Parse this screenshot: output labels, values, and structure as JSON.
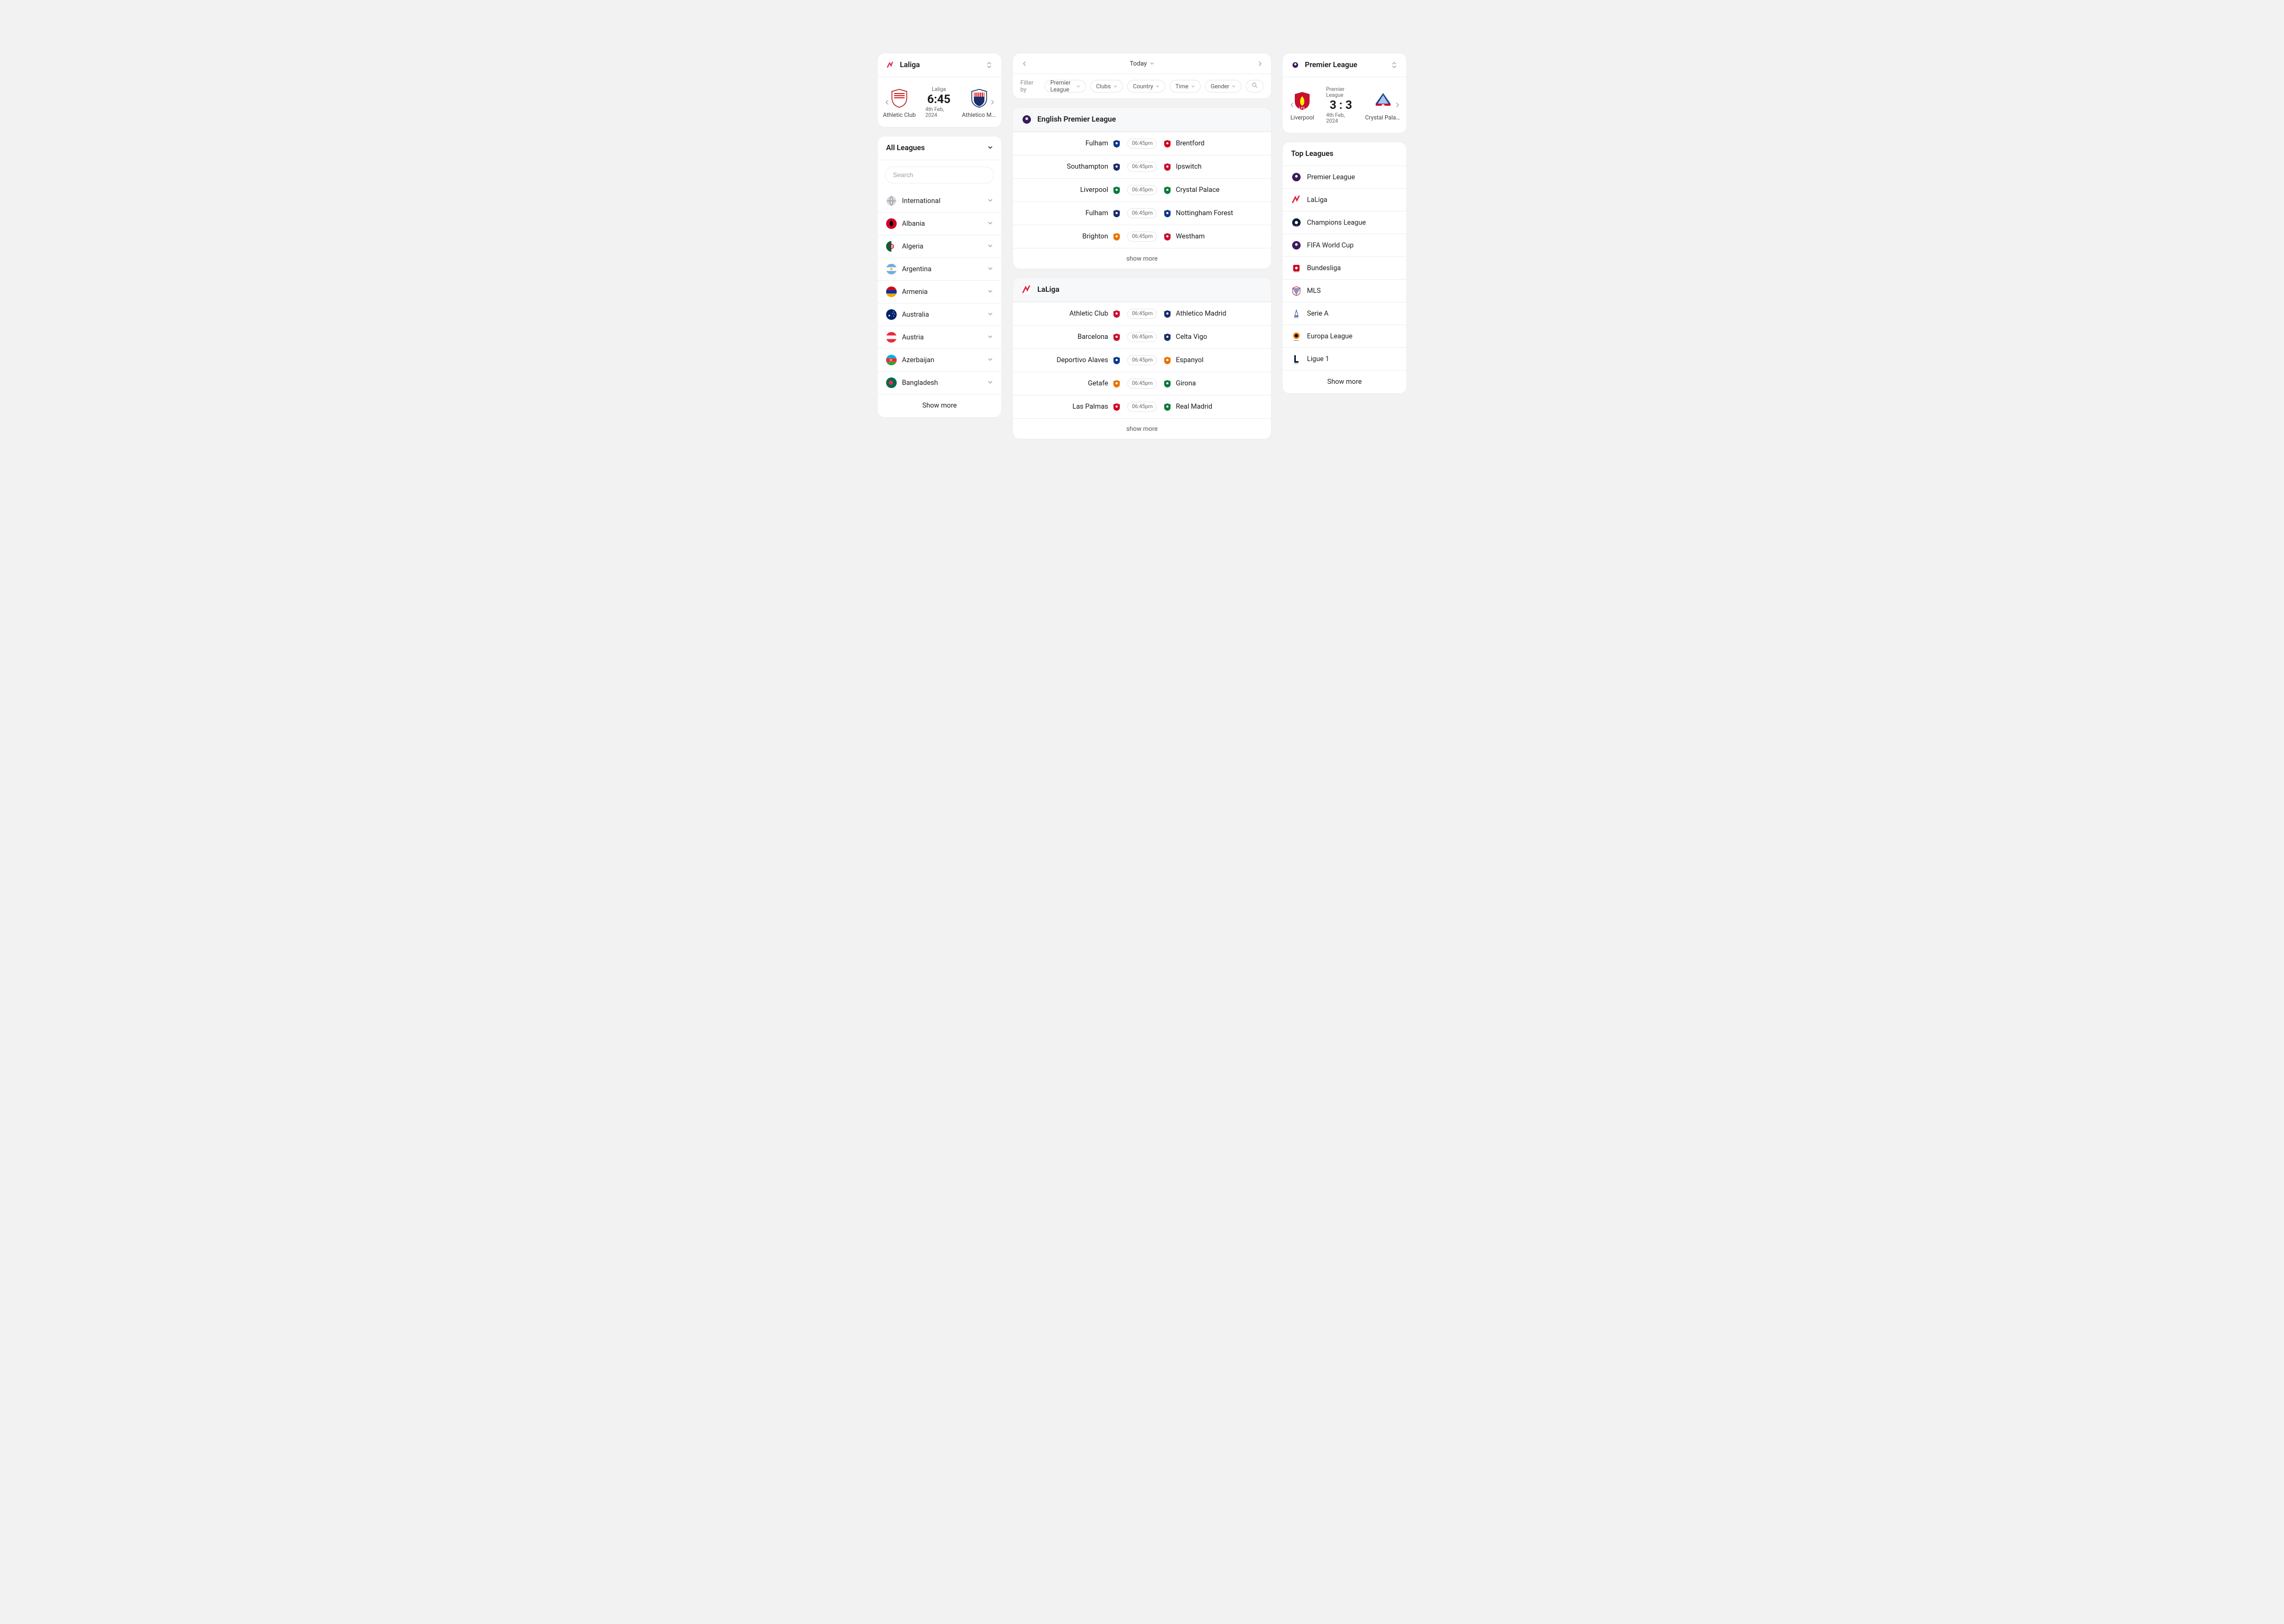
{
  "left": {
    "featured": {
      "title": "Laliga",
      "home": "Athletic Club",
      "away": "Athletico M...",
      "league": "Laliga",
      "score": "6:45",
      "date": "4th Feb, 2024"
    },
    "all_title": "All Leagues",
    "search_placeholder": "Search",
    "countries": [
      {
        "name": "International",
        "flag": "globe"
      },
      {
        "name": "Albania",
        "flag": "albania"
      },
      {
        "name": "Algeria",
        "flag": "algeria"
      },
      {
        "name": "Argentina",
        "flag": "argentina"
      },
      {
        "name": "Armenia",
        "flag": "armenia"
      },
      {
        "name": "Australia",
        "flag": "australia"
      },
      {
        "name": "Austria",
        "flag": "austria"
      },
      {
        "name": "Azerbaijan",
        "flag": "azerbaijan"
      },
      {
        "name": "Bangladesh",
        "flag": "bangladesh"
      }
    ],
    "show_more": "Show more"
  },
  "center": {
    "date_label": "Today",
    "filter_label": "Filter by",
    "filters": [
      "Premier League",
      "Clubs",
      "Country",
      "Time",
      "Gender"
    ],
    "search_placeholder": "Search",
    "groups": [
      {
        "title": "English Premier League",
        "icon": "epl",
        "matches": [
          {
            "home": "Fulham",
            "away": "Brentford",
            "time": "06:45pm"
          },
          {
            "home": "Southampton",
            "away": "Ipswitch",
            "time": "06:45pm"
          },
          {
            "home": "Liverpool",
            "away": "Crystal Palace",
            "time": "06:45pm"
          },
          {
            "home": "Fulham",
            "away": "Nottingham Forest",
            "time": "06:45pm"
          },
          {
            "home": "Brighton",
            "away": "Westham",
            "time": "06:45pm"
          }
        ],
        "show_more": "show more"
      },
      {
        "title": "LaLiga",
        "icon": "laliga",
        "matches": [
          {
            "home": "Athletic Club",
            "away": "Athletico Madrid",
            "time": "06:45pm"
          },
          {
            "home": "Barcelona",
            "away": "Celta Vigo",
            "time": "06:45pm"
          },
          {
            "home": "Deportivo Alaves",
            "away": "Espanyol",
            "time": "06:45pm"
          },
          {
            "home": "Getafe",
            "away": "Girona",
            "time": "06:45pm"
          },
          {
            "home": "Las Palmas",
            "away": "Real Madrid",
            "time": "06:45pm"
          }
        ],
        "show_more": "show more"
      }
    ]
  },
  "right": {
    "featured": {
      "title": "Premier League",
      "home": "Liverpool",
      "away": "Crystal Palace",
      "league": "Premier League",
      "score": "3 : 3",
      "date": "4th Feb, 2024"
    },
    "top_title": "Top Leagues",
    "top_leagues": [
      {
        "name": "Premier League",
        "icon": "epl"
      },
      {
        "name": "LaLiga",
        "icon": "laliga"
      },
      {
        "name": "Champions League",
        "icon": "ucl"
      },
      {
        "name": "FIFA World Cup",
        "icon": "fifa"
      },
      {
        "name": "Bundesliga",
        "icon": "bundesliga"
      },
      {
        "name": "MLS",
        "icon": "mls"
      },
      {
        "name": "Serie A",
        "icon": "seriea"
      },
      {
        "name": "Europa League",
        "icon": "uel"
      },
      {
        "name": "Ligue 1",
        "icon": "ligue1"
      }
    ],
    "show_more": "Show more"
  }
}
